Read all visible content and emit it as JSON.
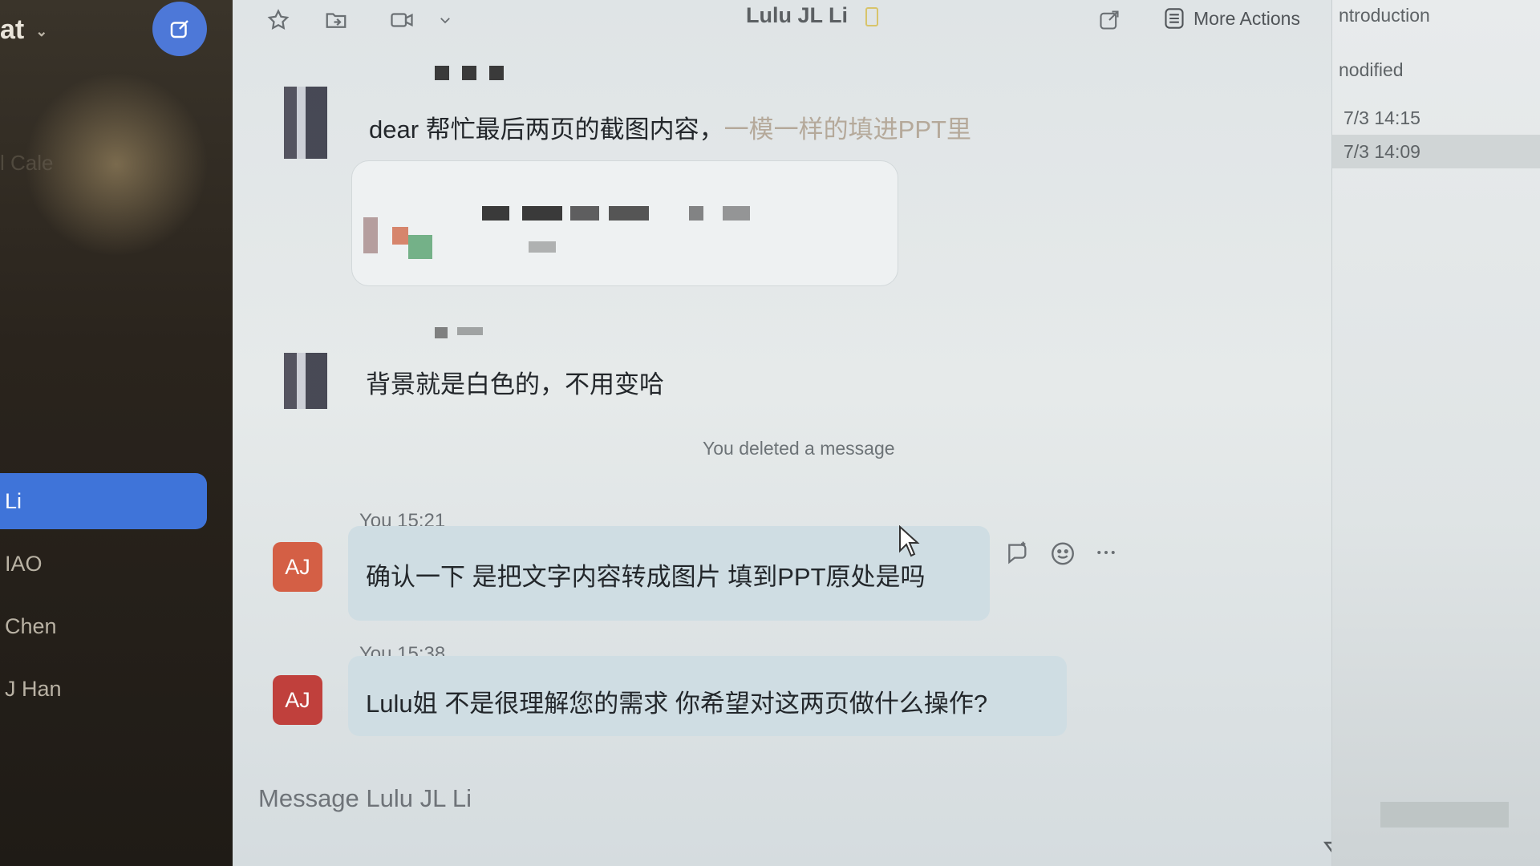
{
  "sidebar": {
    "title": "at",
    "faded_items": [
      "l Cale"
    ],
    "items": [
      {
        "label": "Li",
        "active": true
      },
      {
        "label": "IAO",
        "active": false
      },
      {
        "label": "Chen",
        "active": false
      },
      {
        "label": "J Han",
        "active": false
      }
    ]
  },
  "header": {
    "title": "Lulu JL Li",
    "more_actions_label": "More Actions"
  },
  "messages": [
    {
      "text_main": "dear 帮忙最后两页的截图内容，",
      "text_faint": "一模一样的填进PPT里"
    },
    {
      "text_main": "背景就是白色的，不用变哈"
    }
  ],
  "system_notice": "You deleted a message",
  "my_messages": [
    {
      "sender": "You",
      "time": "15:21",
      "avatar": "AJ",
      "text": "确认一下 是把文字内容转成图片 填到PPT原处是吗"
    },
    {
      "sender": "You",
      "time": "15:38",
      "avatar": "AJ",
      "text": "Lulu姐 不是很理解您的需求 你希望对这两页做什么操作?"
    }
  ],
  "composer": {
    "placeholder": "Message Lulu JL Li"
  },
  "right_panel": {
    "rows": [
      "ntroduction",
      "nodified",
      "7/3 14:15",
      "7/3 14:09"
    ]
  },
  "colors": {
    "accent": "#3f74d9",
    "avatar_aj_1": "#d45f45",
    "avatar_aj_2": "#c0403c",
    "bubble": "#cfdde3"
  }
}
